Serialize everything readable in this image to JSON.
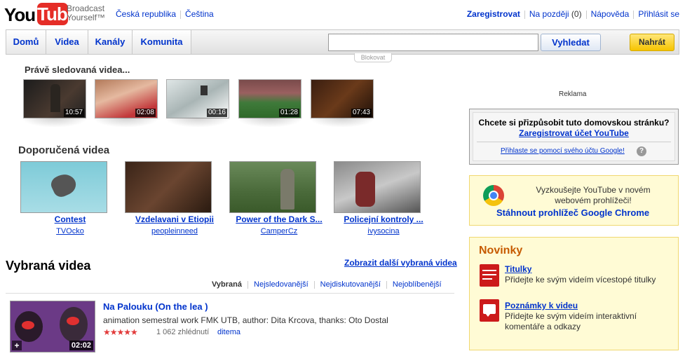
{
  "header": {
    "logo_you": "You",
    "logo_tube": "Tube",
    "tagline_1": "Broadcast",
    "tagline_2": "Yourself™",
    "region": "Česká republika",
    "language": "Čeština",
    "register": "Zaregistrovat",
    "watch_later": "Na později",
    "watch_later_count": "(0)",
    "help": "Nápověda",
    "login": "Přihlásit se"
  },
  "nav": {
    "tabs": [
      "Domů",
      "Videa",
      "Kanály",
      "Komunita"
    ],
    "search_placeholder": "",
    "search_button": "Vyhledat",
    "upload_button": "Nahrát",
    "block_label": "Blokovat"
  },
  "recent": {
    "title": "Právě sledovaná videa...",
    "items": [
      {
        "duration": "10:57"
      },
      {
        "duration": "02:08"
      },
      {
        "duration": "00:16"
      },
      {
        "duration": "01:28"
      },
      {
        "duration": "07:43"
      }
    ]
  },
  "recommended": {
    "title": "Doporučená videa",
    "items": [
      {
        "title": "Contest",
        "user": "TVOcko"
      },
      {
        "title": "Vzdelavani v Etiopii",
        "user": "peopleinneed"
      },
      {
        "title": "Power of the Dark S...",
        "user": "CamperCz"
      },
      {
        "title": "Policejní kontroly ...",
        "user": "ivysocina"
      }
    ]
  },
  "featured": {
    "title": "Vybraná videa",
    "more_link": "Zobrazit další vybraná videa",
    "tabs": [
      "Vybraná",
      "Nejsledovanější",
      "Nejdiskutovanější",
      "Nejoblíbenější"
    ],
    "video": {
      "title": "Na Palouku (On the lea )",
      "description": "animation semestral work FMK UTB, author: Dita Krcova, thanks: Oto Dostal",
      "stars": "★★★★★",
      "views": "1 062 zhlédnutí",
      "user": "ditema",
      "duration": "02:02",
      "add_icon": "+"
    }
  },
  "sidebar": {
    "ad_label": "Reklama",
    "customize_question": "Chcete si přizpůsobit tuto domovskou stránku?",
    "customize_register": "Zaregistrovat účet YouTube",
    "customize_google": "Přihlaste se pomocí svého účtu Google!",
    "help_icon": "?",
    "chrome_text_1": "Vyzkoušejte YouTube v novém",
    "chrome_text_2": "webovém prohlížeči!",
    "chrome_link": "Stáhnout prohlížeč Google Chrome",
    "news_title": "Novinky",
    "news_items": [
      {
        "title": "Titulky",
        "text_1": "Přidejte ke svým videím vícestopé titulky",
        "text_2": ""
      },
      {
        "title": "Poznámky k videu",
        "text_1": "Přidejte ke svým videím interaktivní",
        "text_2": "komentáře a odkazy"
      }
    ]
  }
}
